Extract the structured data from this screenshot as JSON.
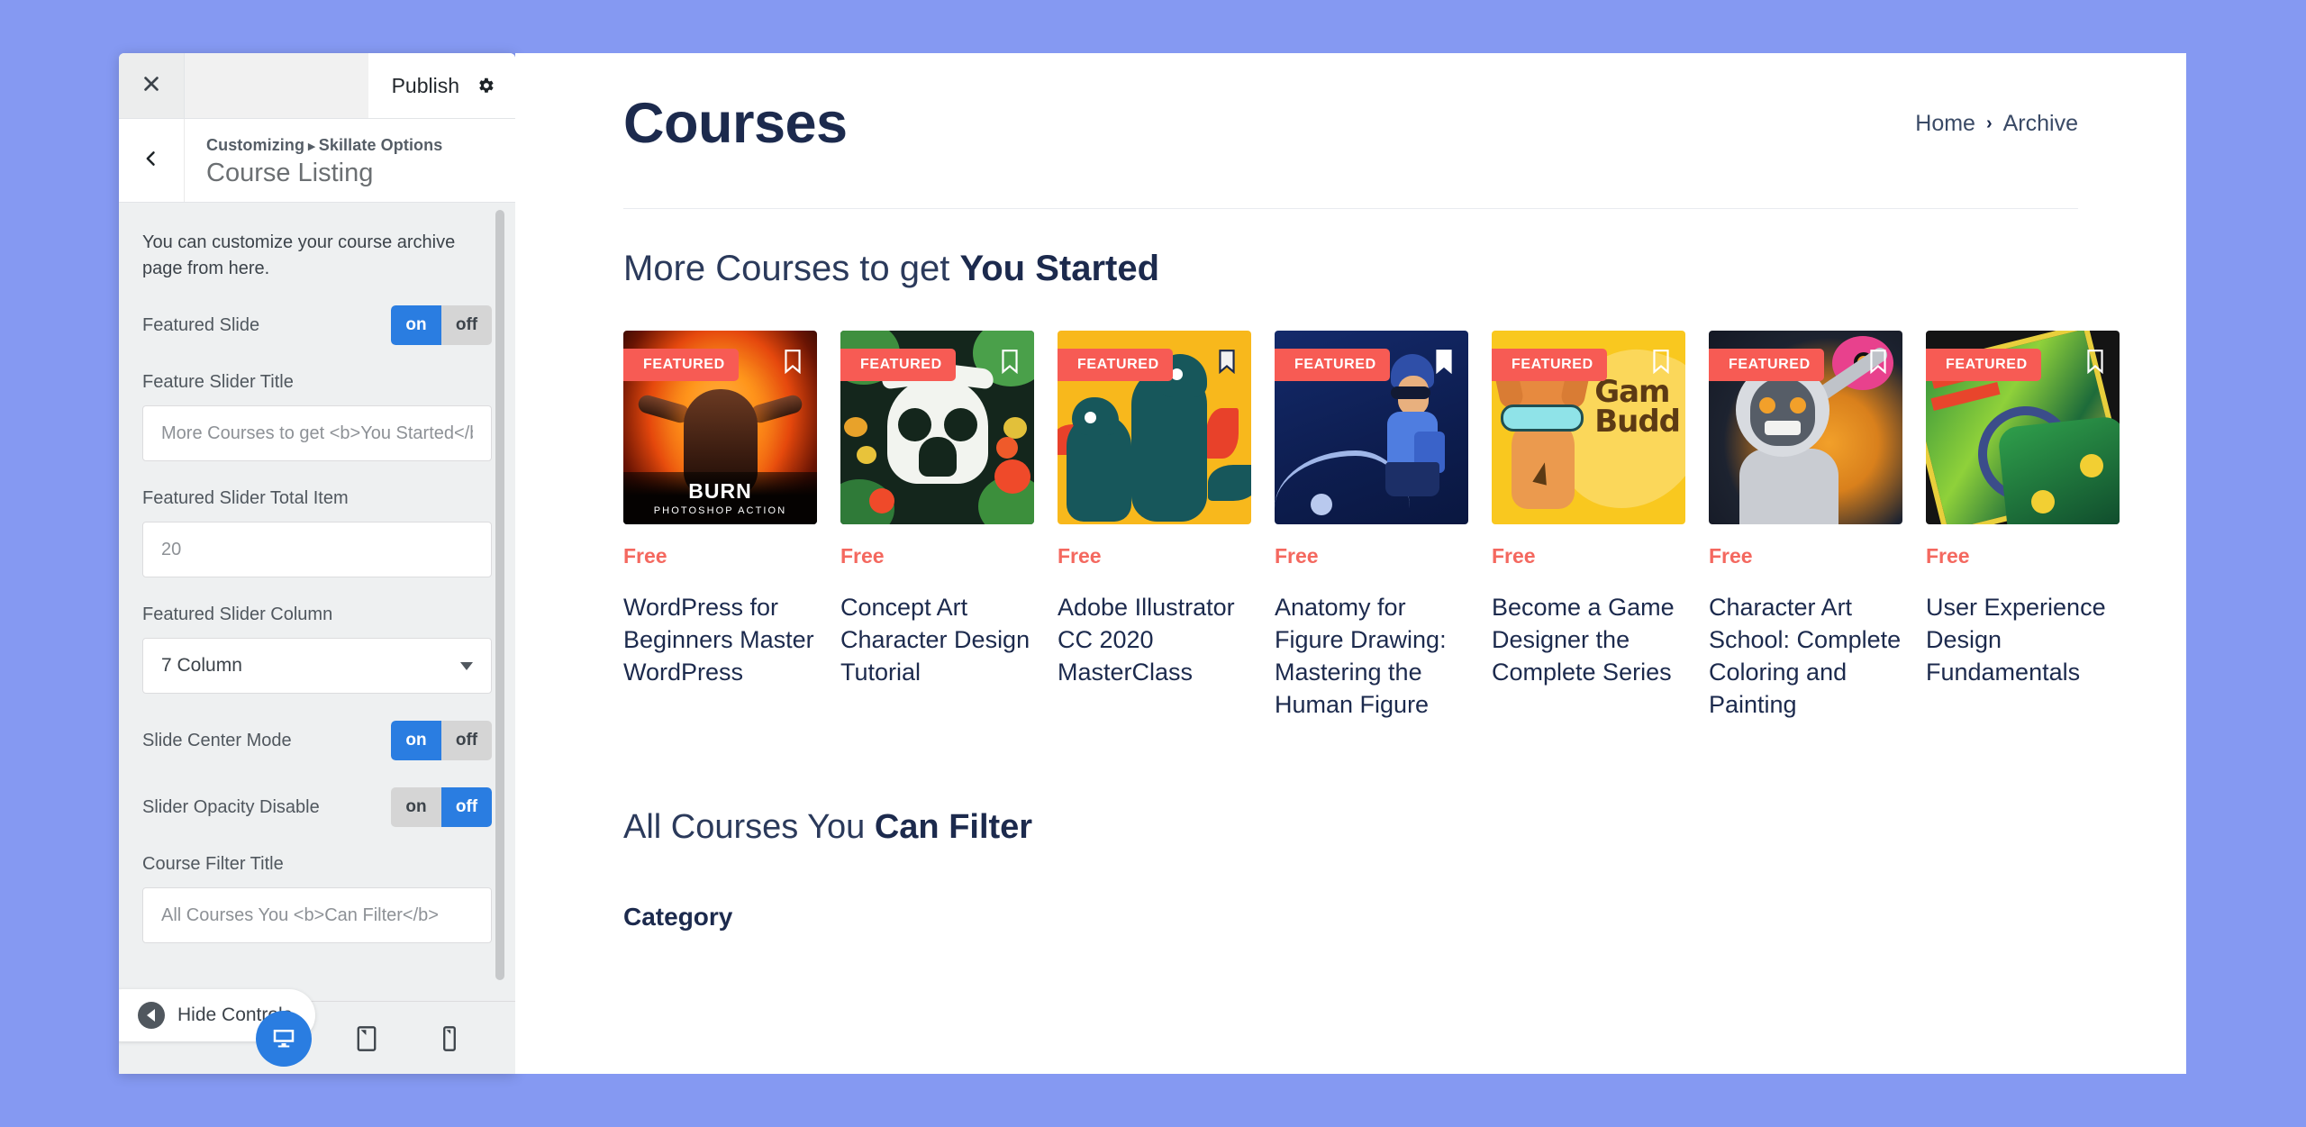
{
  "customizer": {
    "close_icon": "close-icon",
    "publish_label": "Publish",
    "gear_icon": "gear-icon",
    "back_icon": "chevron-left-icon",
    "breadcrumb_root": "Customizing",
    "breadcrumb_sep": "▸",
    "breadcrumb_section": "Skillate Options",
    "panel_title": "Course Listing",
    "description": "You can customize your course archive page from here.",
    "controls": [
      {
        "type": "toggle",
        "label": "Featured Slide",
        "on_label": "on",
        "off_label": "off",
        "value": "on"
      },
      {
        "type": "text",
        "label": "Feature Slider Title",
        "placeholder": "More Courses to get <b>You Started</b>",
        "value": ""
      },
      {
        "type": "text",
        "label": "Featured Slider Total Item",
        "placeholder": "20",
        "value": ""
      },
      {
        "type": "select",
        "label": "Featured Slider Column",
        "value": "7 Column"
      },
      {
        "type": "toggle",
        "label": "Slide Center Mode",
        "on_label": "on",
        "off_label": "off",
        "value": "on"
      },
      {
        "type": "toggle",
        "label": "Slider Opacity Disable",
        "on_label": "on",
        "off_label": "off",
        "value": "off"
      },
      {
        "type": "text",
        "label": "Course Filter Title",
        "placeholder": "All Courses You <b>Can Filter</b>",
        "value": ""
      }
    ],
    "footer": {
      "hide_controls_label": "Hide Controls",
      "devices": [
        {
          "name": "desktop-preview",
          "icon": "desktop-icon",
          "active": true
        },
        {
          "name": "tablet-preview",
          "icon": "tablet-icon",
          "active": false
        },
        {
          "name": "mobile-preview",
          "icon": "mobile-icon",
          "active": false
        }
      ]
    },
    "accent_color": "#2a7de1"
  },
  "preview": {
    "page_title": "Courses",
    "breadcrumb": {
      "home": "Home",
      "separator": "›",
      "current": "Archive"
    },
    "section_title_normal": "More Courses to get ",
    "section_title_bold": "You Started",
    "filter_title_normal": "All Courses You ",
    "filter_title_bold": "Can Filter",
    "category_label": "Category",
    "badge_label": "FEATURED",
    "badge_color": "#f75b54",
    "price_color": "#f4685f",
    "title_color": "#1c2a4d",
    "bookmark_icon": "bookmark-icon",
    "courses": [
      {
        "title": "WordPress for Beginners Master WordPress",
        "price": "Free",
        "badge": "FEATURED",
        "art": "art1",
        "thumb_text_main": "BURN",
        "thumb_text_sub": "PHOTOSHOP ACTION"
      },
      {
        "title": "Concept Art Character Design Tutorial",
        "price": "Free",
        "badge": "FEATURED",
        "art": "art2"
      },
      {
        "title": "Adobe Illustrator CC 2020 MasterClass",
        "price": "Free",
        "badge": "FEATURED",
        "art": "art3"
      },
      {
        "title": "Anatomy for Figure Drawing: Mastering the Human Figure",
        "price": "Free",
        "badge": "FEATURED",
        "art": "art4"
      },
      {
        "title": "Become a Game Designer the Complete Series",
        "price": "Free",
        "badge": "FEATURED",
        "art": "art5",
        "thumb_text_main": "Gam\nBudd"
      },
      {
        "title": "Character Art School: Complete Coloring and Painting",
        "price": "Free",
        "badge": "FEATURED",
        "art": "art6"
      },
      {
        "title": "User Experience Design Fundamentals",
        "price": "Free",
        "badge": "FEATURED",
        "art": "art7"
      }
    ]
  }
}
